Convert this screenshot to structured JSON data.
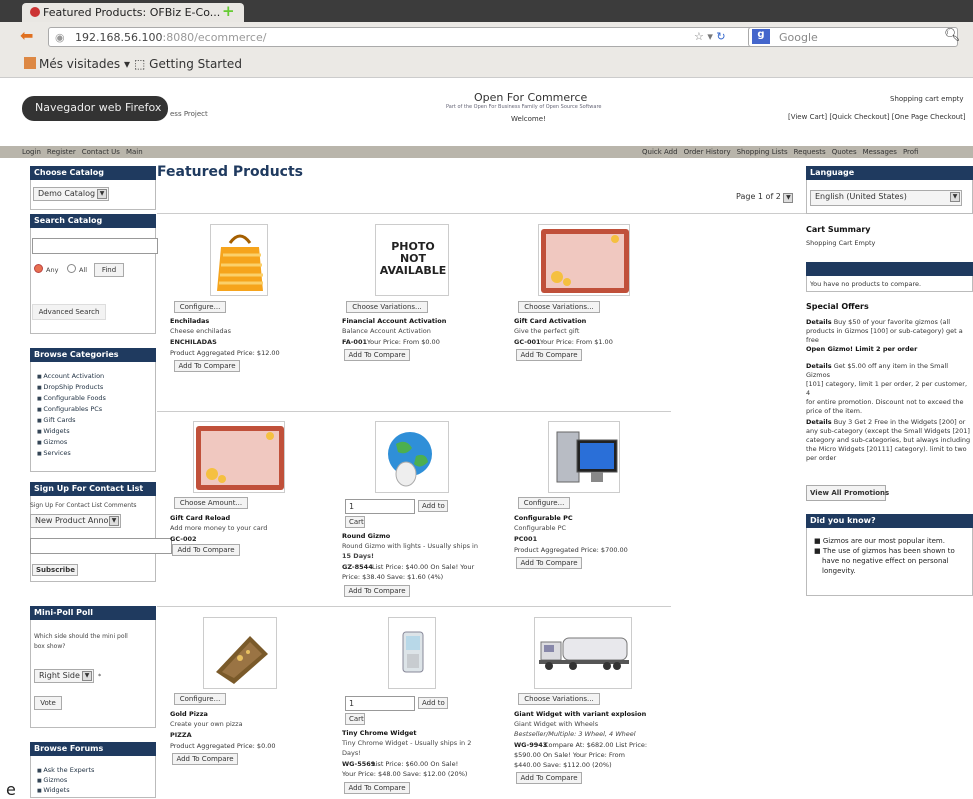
{
  "browser": {
    "tab_title": "Featured Products: OFBiz E-Co...",
    "url_host": "192.168.56.100",
    "url_rest": ":8080/ecommerce/",
    "search_placeholder": "Google",
    "bookmarks": [
      "Més visitades ▾",
      "Getting Started"
    ],
    "tooltip": "Navegador web Firefox"
  },
  "header": {
    "project": "ess Project",
    "title": "Open For Commerce",
    "subtitle": "Part of the Open For Business Family of Open Source Software",
    "welcome": "Welcome!",
    "cart_status": "Shopping cart empty",
    "cart_links": "[View Cart] [Quick Checkout] [One Page Checkout]"
  },
  "menu": {
    "left": [
      "Login",
      "Register",
      "Contact Us",
      "Main"
    ],
    "right": [
      "Quick Add",
      "Order History",
      "Shopping Lists",
      "Requests",
      "Quotes",
      "Messages",
      "Profi"
    ]
  },
  "left": {
    "choose_catalog": {
      "title": "Choose Catalog",
      "value": "Demo Catalog"
    },
    "search": {
      "title": "Search Catalog",
      "any": "Any",
      "all": "All",
      "find": "Find",
      "advanced": "Advanced Search"
    },
    "browse": {
      "title": "Browse Categories",
      "items": [
        "Account Activation",
        "DropShip Products",
        "Configurable Foods",
        "Configurables PCs",
        "Gift Cards",
        "Widgets",
        "Gizmos",
        "Services"
      ]
    },
    "signup": {
      "title": "Sign Up For Contact List",
      "hint": "Sign Up For Contact List Comments",
      "select": "New Product Annou",
      "button": "Subscribe"
    },
    "poll": {
      "title": "Mini-Poll Poll",
      "question1": "Which side should the mini poll",
      "question2": "box show?",
      "select": "Right Side",
      "vote": "Vote"
    },
    "forums": {
      "title": "Browse Forums",
      "items": [
        "Ask the Experts",
        "Gizmos",
        "Widgets"
      ]
    }
  },
  "main": {
    "title": "Featured Products",
    "pager": "Page 1 of 2",
    "products": [
      {
        "button": "Configure...",
        "name": "Enchiladas",
        "desc": "Cheese enchiladas",
        "code": "ENCHILADAS",
        "price": "Product Aggregated Price: $12.00",
        "add": "Add To Compare",
        "icon": "orange-bag-icon"
      },
      {
        "button": "Choose Variations...",
        "name": "Financial Account Activation",
        "desc": "Balance Account Activation",
        "code": "FA-001",
        "price": "Your Price: From $0.00",
        "add": "Add To Compare",
        "photo": "PHOTO NOT AVAILABLE"
      },
      {
        "button": "Choose Variations...",
        "name": "Gift Card Activation",
        "desc": "Give the perfect gift",
        "code": "GC-001",
        "price": "Your Price: From $1.00",
        "add": "Add To Compare",
        "icon": "gift-card-icon"
      },
      {
        "button": "Choose Amount...",
        "name": "Gift Card Reload",
        "desc": "Add more money to your card",
        "code": "GC-002",
        "add": "Add To Compare",
        "icon": "gift-card-icon"
      },
      {
        "qty": "1",
        "add_to": "Add to",
        "cart": "Cart",
        "name": "Round Gizmo",
        "desc": "Round Gizmo with lights - Usually ships in",
        "desc2": "15 Days!",
        "code": "GZ-8544",
        "price": "List Price: $40.00 On Sale! Your",
        "price2": "Price: $38.40 Save: $1.60 (4%)",
        "add": "Add To Compare",
        "icon": "globe-mouse-icon"
      },
      {
        "button": "Configure...",
        "name": "Configurable PC",
        "desc": "Configurable PC",
        "code": "PC001",
        "price": "Product Aggregated Price: $700.00",
        "add": "Add To Compare",
        "icon": "desktop-pc-icon"
      },
      {
        "button": "Configure...",
        "name": "Gold Pizza",
        "desc": "Create your own pizza",
        "code": "PIZZA",
        "price": "Product Aggregated Price: $0.00",
        "add": "Add To Compare",
        "icon": "pizza-icon"
      },
      {
        "qty": "1",
        "add_to": "Add to",
        "cart": "Cart",
        "name": "Tiny Chrome Widget",
        "desc": "Tiny Chrome Widget - Usually ships in 2",
        "desc2": "Days!",
        "code": "WG-5569",
        "price": "List Price: $60.00 On Sale!",
        "price2": "Your Price: $48.00 Save: $12.00 (20%)",
        "add": "Add To Compare",
        "icon": "phone-icon"
      },
      {
        "button": "Choose Variations...",
        "name": "Giant Widget with variant explosion",
        "desc": "Giant Widget with Wheels",
        "desc2": "Bestseller/Multiple: 3 Wheel, 4 Wheel",
        "code": "WG-9943",
        "price": "Compare At: $682.00 List Price:",
        "price2": "$590.00 On Sale! Your Price: From",
        "price3": "$440.00 Save: $112.00 (20%)",
        "add": "Add To Compare",
        "icon": "truck-icon"
      }
    ]
  },
  "right": {
    "language": {
      "title": "Language",
      "value": "English (United States)"
    },
    "cart_summary": {
      "title": "Cart Summary",
      "text": "Shopping Cart Empty"
    },
    "compare": "You have no products to compare.",
    "offers": {
      "title": "Special Offers",
      "o1": [
        "Details",
        " Buy $50 of your favorite gizmos (all",
        "products in Gizmos [100] or sub-category) get a free",
        "Open Gizmo! Limit 2 per order"
      ],
      "o2": [
        "Details",
        " Get $5.00 off any item in the Small Gizmos",
        "[101] category, limit 1 per order, 2 per customer, 4",
        "for entire promotion. Discount not to exceed the",
        "price of the item."
      ],
      "o3": [
        "Details",
        " Buy 3 Get 2 Free in the Widgets [200] or",
        "any sub-category (except the Small Widgets [201]",
        "category and sub-categories, but always including",
        "the Micro Widgets [20111] category). limit to two",
        "per order"
      ],
      "view_all": "View All Promotions"
    },
    "did_you_know": {
      "title": "Did you know?",
      "items": [
        "Gizmos are our most popular item.",
        "The use of gizmos has been shown to",
        "have no negative effect on personal",
        "longevity."
      ]
    }
  },
  "stray": "e"
}
